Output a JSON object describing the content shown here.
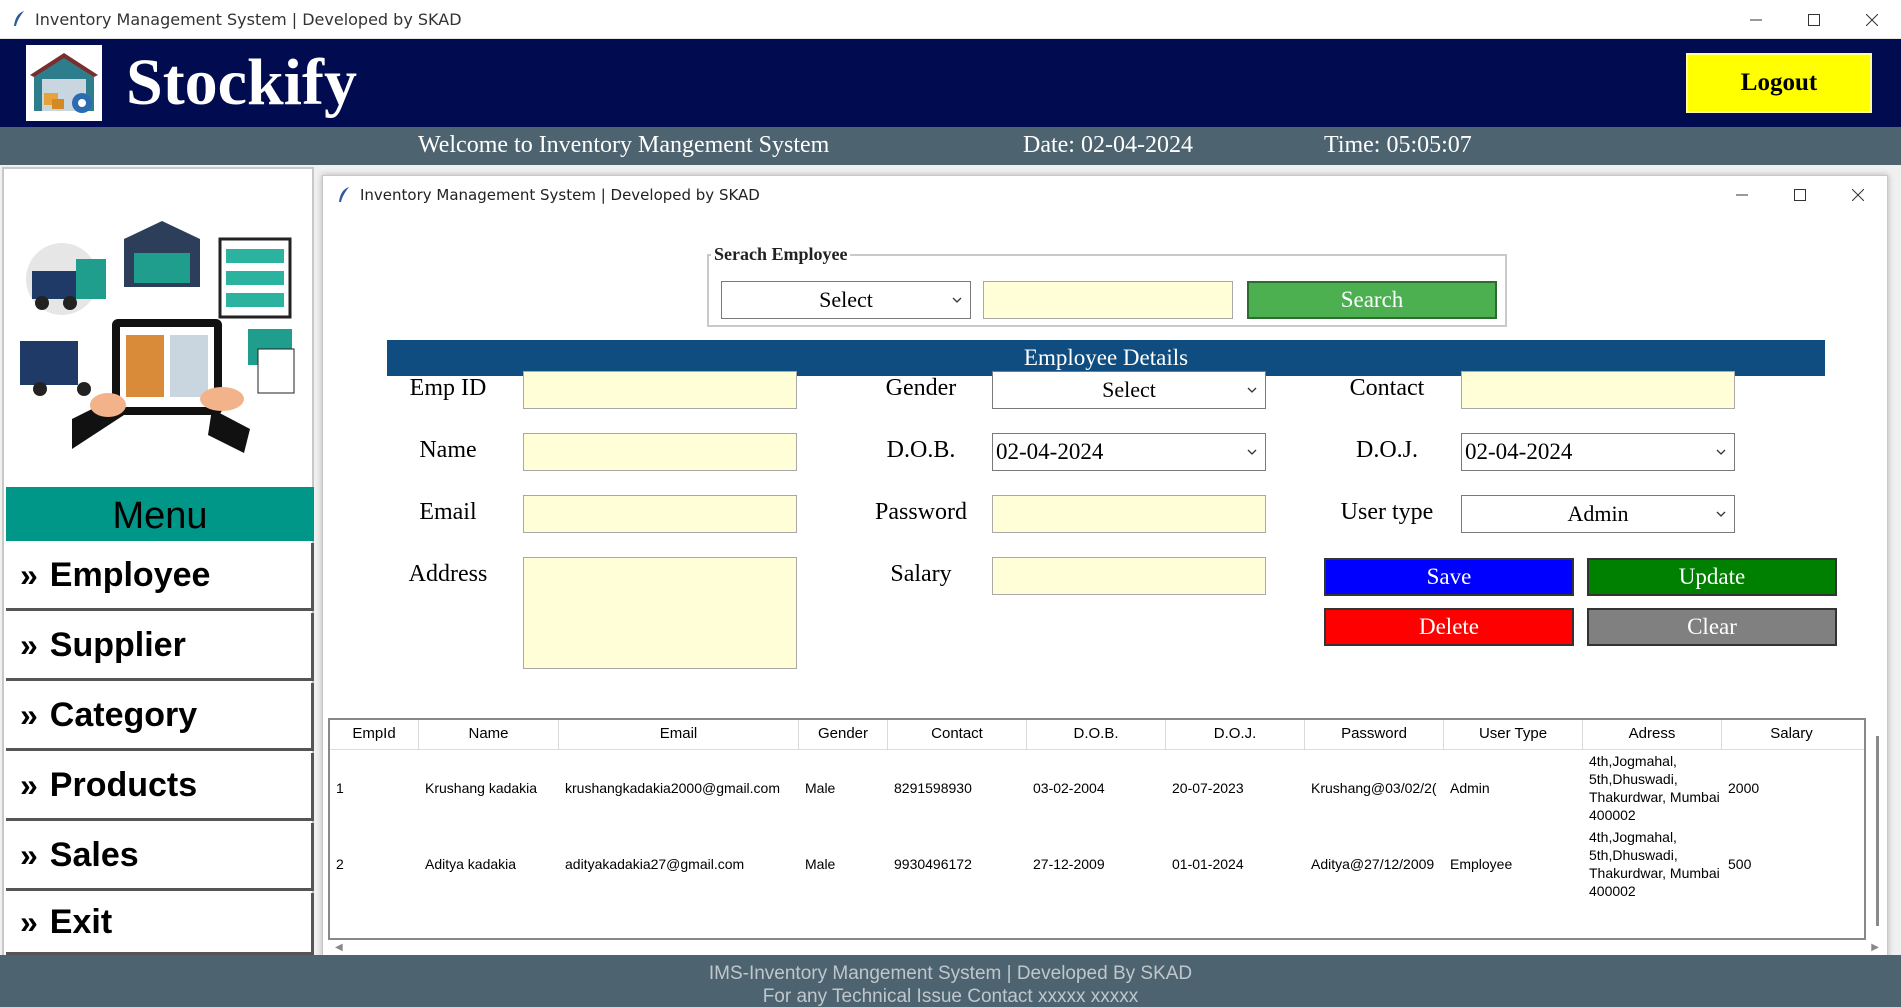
{
  "window": {
    "title": "Inventory Management System | Developed by SKAD"
  },
  "header": {
    "brand": "Stockify",
    "logout_label": "Logout"
  },
  "welcome_bar": {
    "welcome": "Welcome to Inventory Mangement System",
    "date": "Date: 02-04-2024",
    "time": "Time: 05:05:07"
  },
  "menu": {
    "title": "Menu",
    "items": [
      {
        "label": "Employee"
      },
      {
        "label": "Supplier"
      },
      {
        "label": "Category"
      },
      {
        "label": "Products"
      },
      {
        "label": "Sales"
      },
      {
        "label": "Exit"
      }
    ]
  },
  "inner_window": {
    "title": "Inventory Management System | Developed by SKAD"
  },
  "search": {
    "legend": "Serach Employee",
    "select_value": "Select",
    "text_value": "",
    "button_label": "Search"
  },
  "details": {
    "banner": "Employee Details",
    "labels": {
      "emp_id": "Emp ID",
      "name": "Name",
      "email": "Email",
      "address": "Address",
      "gender": "Gender",
      "dob": "D.O.B.",
      "password": "Password",
      "salary": "Salary",
      "contact": "Contact",
      "doj": "D.O.J.",
      "user_type": "User type"
    },
    "values": {
      "gender": "Select",
      "dob": "02-04-2024",
      "doj": "02-04-2024",
      "user_type": "Admin"
    },
    "buttons": {
      "save": "Save",
      "update": "Update",
      "delete": "Delete",
      "clear": "Clear"
    }
  },
  "table": {
    "columns": [
      "EmpId",
      "Name",
      "Email",
      "Gender",
      "Contact",
      "D.O.B.",
      "D.O.J.",
      "Password",
      "User Type",
      "Adress",
      "Salary"
    ],
    "rows": [
      {
        "empid": "1",
        "name": "Krushang kadakia",
        "email": "krushangkadakia2000@gmail.com",
        "gender": "Male",
        "contact": "8291598930",
        "dob": "03-02-2004",
        "doj": "20-07-2023",
        "password": "Krushang@03/02/2(",
        "user_type": "Admin",
        "address": "4th,Jogmahal, 5th,Dhuswadi, Thakurdwar, Mumbai 400002",
        "salary": "2000"
      },
      {
        "empid": "2",
        "name": "Aditya kadakia",
        "email": "adityakadakia27@gmail.com",
        "gender": "Male",
        "contact": "9930496172",
        "dob": "27-12-2009",
        "doj": "01-01-2024",
        "password": "Aditya@27/12/2009",
        "user_type": "Employee",
        "address": "4th,Jogmahal, 5th,Dhuswadi, Thakurdwar, Mumbai 400002",
        "salary": "500"
      }
    ]
  },
  "footer": {
    "line1": "IMS-Inventory Mangement System | Developed By SKAD",
    "line2": "For any Technical Issue Contact xxxxx xxxxx"
  },
  "colors": {
    "header_bg": "#010c50",
    "bar_bg": "#4d636f",
    "menu_title_bg": "#009688",
    "logout_bg": "#ffff00",
    "banner_bg": "#0f4d80",
    "search_btn": "#4caf50",
    "save_btn": "#0000ff",
    "update_btn": "#008000",
    "delete_btn": "#ff0000",
    "clear_btn": "#808080",
    "entry_bg": "#fffed6"
  }
}
